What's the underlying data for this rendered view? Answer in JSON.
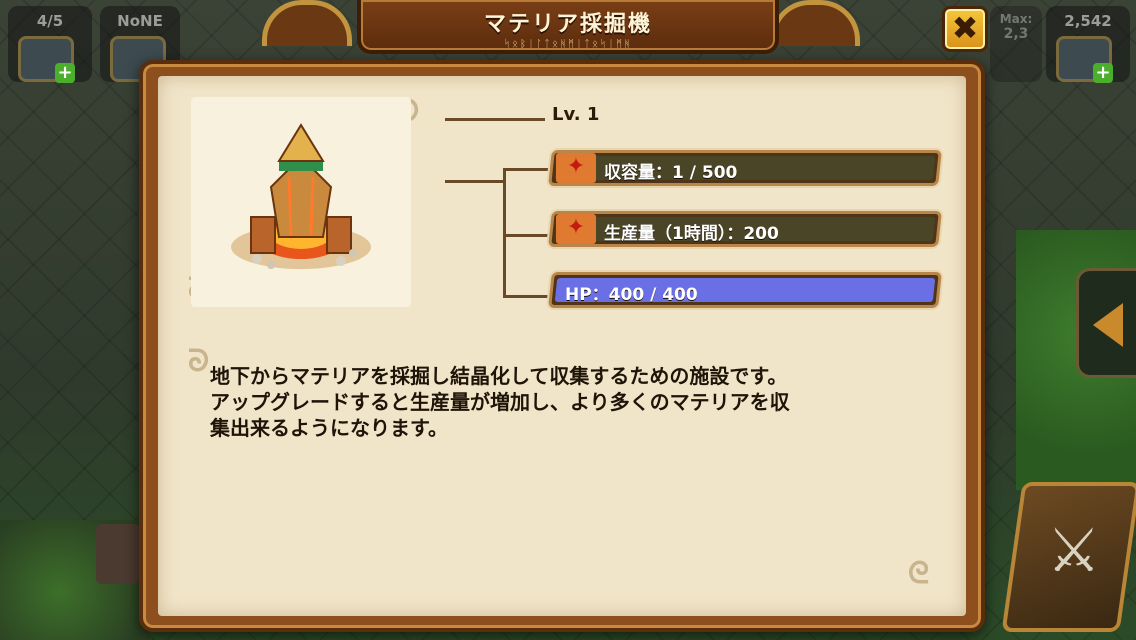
{
  "hud": {
    "slot1_text": "4/5",
    "slot2_text": "NoNE",
    "slot3_text": "2,542",
    "max_label": "Max:",
    "max_value": "2,3"
  },
  "dialog": {
    "title": "マテリア採掘機",
    "title_runes": "ᛋᛟᛒᛁᛚᛏᛟᚻᛗᛁᛏᛟᛋᛁᛗᚻ",
    "close_symbol": "✖",
    "level": "Lv. 1",
    "stats": [
      {
        "label": "収容量：1 / 500",
        "icon": "red-crystal-icon"
      },
      {
        "label": "生産量（1時間）：200",
        "icon": "red-crystal-icon"
      },
      {
        "label": "HP：400 / 400",
        "icon": "hp-bar"
      }
    ],
    "description": "地下からマテリアを採掘し結晶化して収集するための施設です。\nアップグレードすると生産量が増加し、より多くのマテリアを収\n集出来るようになります。"
  },
  "colors": {
    "frame_brown": "#8e4f1e",
    "parchment": "#f1e5c9",
    "stat_bar": "#4a4526",
    "hp_bar": "#6b6fe6",
    "close_yellow": "#f5c73a"
  }
}
